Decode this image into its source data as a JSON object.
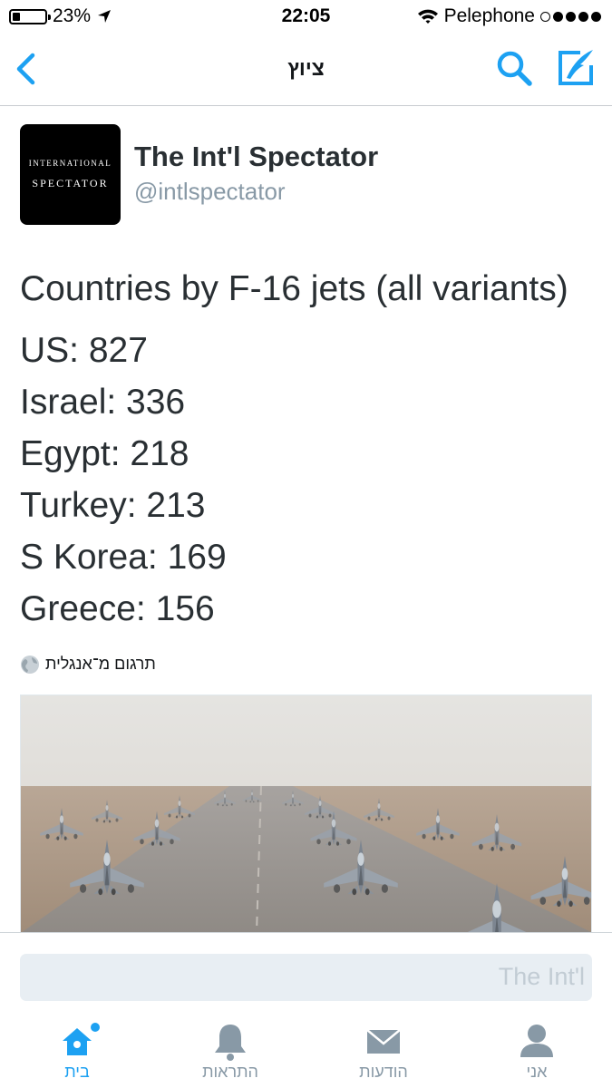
{
  "status_bar": {
    "battery": "23%",
    "battery_level": 0.23,
    "time": "22:05",
    "carrier": "Pelephone",
    "signal_bars_filled": 4,
    "signal_bars_total": 5
  },
  "nav": {
    "title": "ציוץ",
    "back_icon": "chevron-left-icon",
    "search_icon": "search-icon",
    "compose_icon": "compose-icon"
  },
  "tweet": {
    "author_name": "The Int'l Spectator",
    "author_handle": "@intlspectator",
    "avatar_line1": "INTERNATIONAL",
    "avatar_line2": "SPECTATOR",
    "headline": "Countries by F-16 jets (all variants)",
    "lines": [
      "US: 827",
      "Israel: 336",
      "Egypt: 218",
      "Turkey: 213",
      "S Korea: 169",
      "Greece: 156"
    ],
    "translate_label": "תרגום מ־אנגלית",
    "photo": "F-16 fighter jets lined up on a runway"
  },
  "reply": {
    "placeholder": "The Int'l"
  },
  "tabs": [
    {
      "label": "בית",
      "icon": "home-icon",
      "active": true,
      "has_badge": true
    },
    {
      "label": "התראות",
      "icon": "bell-icon",
      "active": false
    },
    {
      "label": "הודעות",
      "icon": "envelope-icon",
      "active": false
    },
    {
      "label": "אני",
      "icon": "person-icon",
      "active": false
    }
  ],
  "colors": {
    "accent": "#1da1f2",
    "tab_inactive": "#8899a6",
    "text": "#292f33",
    "secondary_text": "#8899a6"
  }
}
